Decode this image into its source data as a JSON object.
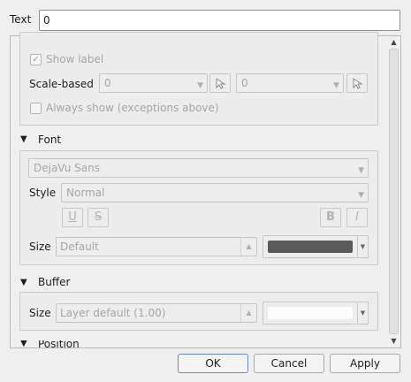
{
  "text_field": {
    "label": "Text",
    "value": "0"
  },
  "visibility": {
    "show_label": "Show label",
    "show_label_checked": true,
    "scale_based_label": "Scale-based",
    "scale_min": "0",
    "scale_max": "0",
    "always_show": "Always show (exceptions above)"
  },
  "font": {
    "title": "Font",
    "family": "DejaVu Sans",
    "style_label": "Style",
    "style_value": "Normal",
    "underline": "U",
    "strike": "S",
    "bold": "B",
    "italic": "I",
    "size_label": "Size",
    "size_value": "Default",
    "color": "#5a5a5a"
  },
  "buffer": {
    "title": "Buffer",
    "size_label": "Size",
    "size_value": "Layer default (1.00)",
    "color": "#fbfbfb"
  },
  "position": {
    "title": "Position"
  },
  "buttons": {
    "ok": "OK",
    "cancel": "Cancel",
    "apply": "Apply"
  }
}
